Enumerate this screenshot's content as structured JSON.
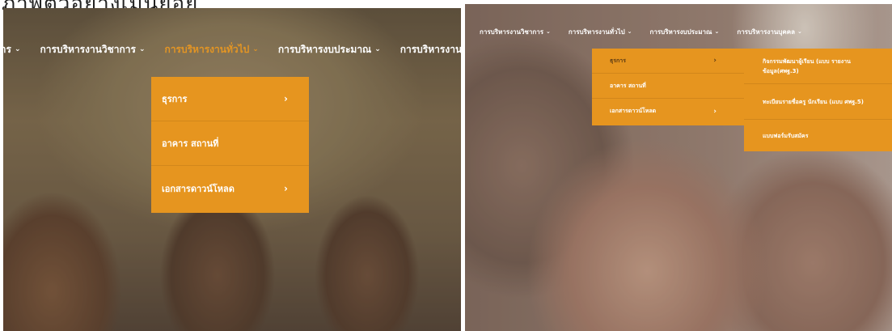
{
  "caption": "ภาพตัวอย่างเมนูย่อย",
  "left_panel": {
    "nav": [
      {
        "label": "ฝ่ายบริหาร",
        "active": false
      },
      {
        "label": "การบริหารงานวิชาการ",
        "active": false
      },
      {
        "label": "การบริหารงานทั่วไป",
        "active": true
      },
      {
        "label": "การบริหารงบประมาณ",
        "active": false
      },
      {
        "label": "การบริหารงานบุคคล",
        "active": false
      }
    ],
    "dropdown": [
      {
        "label": "ธุรการ",
        "has_submenu": true
      },
      {
        "label": "อาคาร สถานที่",
        "has_submenu": false
      },
      {
        "label": "เอกสารดาวน์โหลด",
        "has_submenu": true
      }
    ]
  },
  "right_panel": {
    "nav": [
      {
        "label": "การบริหารงานวิชาการ"
      },
      {
        "label": "การบริหารงานทั่วไป"
      },
      {
        "label": "การบริหารงบประมาณ"
      },
      {
        "label": "การบริหารงานบุคคล"
      }
    ],
    "dropdown": [
      {
        "label": "ธุรการ",
        "has_submenu": true
      },
      {
        "label": "อาคาร สถานที่",
        "has_submenu": false
      },
      {
        "label": "เอกสารดาวน์โหลด",
        "has_submenu": true
      }
    ],
    "submenu": [
      {
        "label": "กิจกรรมพัฒนาผู้เรียน (แบบ รายงานข้อมูล(ศพฐ.3)"
      },
      {
        "label": "ทะเบียนรายชื่อครู นักเรียน (แบบ ศพฐ.5)"
      },
      {
        "label": "แบบฟอร์มรับสมัคร"
      }
    ]
  },
  "icons": {
    "chevron_down": "⌄",
    "chevron_right": "›"
  },
  "colors": {
    "menu_bg": "#e6951f",
    "active_nav": "#e39524",
    "nav_text": "#ffffff"
  }
}
